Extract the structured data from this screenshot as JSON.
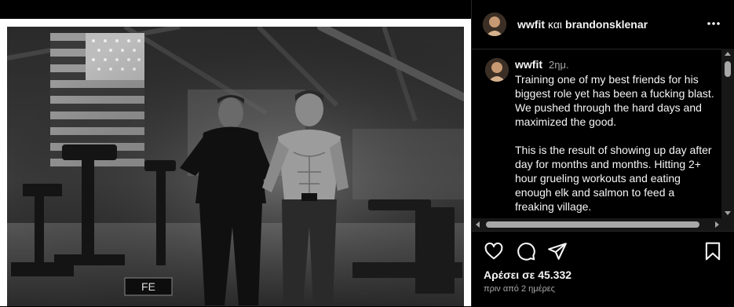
{
  "header": {
    "username1": "wwfit",
    "connector": "και",
    "username2": "brandonsklenar",
    "more_icon": "more-horizontal-icon"
  },
  "caption": {
    "username": "wwfit",
    "time": "2ημ.",
    "paragraphs": [
      "Training one of my best friends for his biggest role yet has been a fucking blast. We pushed through the hard days and maximized the good.",
      "This is the result of showing up day after day for months and months. Hitting 2+ hour grueling workouts and eating enough elk and salmon to feed a freaking village."
    ]
  },
  "photo": {
    "sign_text": "FE"
  },
  "actions": {
    "like_icon": "heart-icon",
    "comment_icon": "comment-icon",
    "share_icon": "send-icon",
    "save_icon": "bookmark-icon"
  },
  "likes": "Αρέσει σε 45.332",
  "date": "πριν από 2 ημέρες",
  "colors": {
    "background": "#000000",
    "text": "#f5f5f5",
    "secondary_text": "#a8a8a8",
    "divider": "#262626"
  }
}
